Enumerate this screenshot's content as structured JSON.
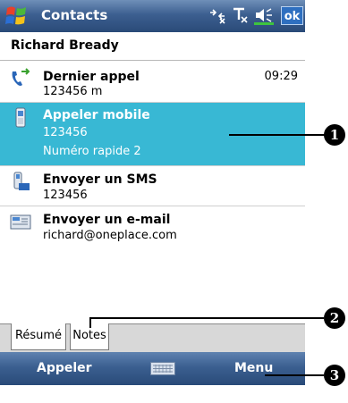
{
  "titlebar": {
    "title": "Contacts",
    "ok_label": "ok",
    "icons": [
      "windows-start-icon",
      "connectivity-icon",
      "signal-icon",
      "volume-icon"
    ]
  },
  "contact": {
    "name": "Richard Bready"
  },
  "items": [
    {
      "icon": "phone-call-icon",
      "title": "Dernier appel",
      "subtitle": "123456 m",
      "time": "09:29"
    },
    {
      "icon": "mobile-phone-icon",
      "title": "Appeler mobile",
      "subtitle": "123456",
      "subtitle2": "Numéro rapide 2",
      "selected": true
    },
    {
      "icon": "sms-icon",
      "title": "Envoyer un SMS",
      "subtitle": "123456"
    },
    {
      "icon": "email-icon",
      "title": "Envoyer un e-mail",
      "subtitle": "richard@oneplace.com"
    }
  ],
  "tabs": [
    {
      "label": "Résumé",
      "active": true
    },
    {
      "label": "Notes",
      "active": false
    }
  ],
  "menubar": {
    "left_label": "Appeler",
    "right_label": "Menu",
    "center_icon": "keyboard-icon"
  },
  "callouts": [
    "1",
    "2",
    "3"
  ],
  "colors": {
    "selection": "#38b8d4",
    "titlebar": "#3c5f90",
    "ok_button": "#2e6fc0"
  }
}
